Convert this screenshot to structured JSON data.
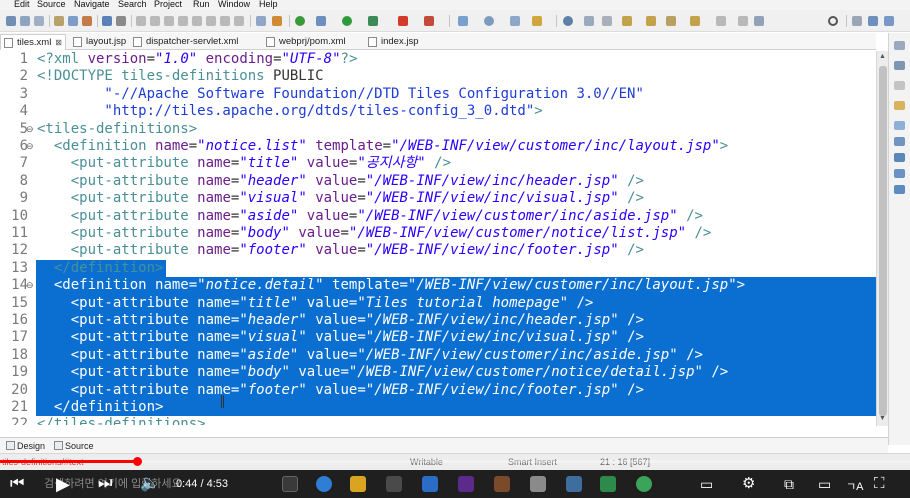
{
  "menu": [
    "Edit",
    "Source",
    "Navigate",
    "Search",
    "Project",
    "Run",
    "Window",
    "Help"
  ],
  "tabs": [
    {
      "label": "tiles.xml",
      "active": true,
      "close": "⊠"
    },
    {
      "label": "layout.jsp"
    },
    {
      "label": "dispatcher-servlet.xml"
    },
    {
      "label": "webprj/pom.xml"
    },
    {
      "label": "index.jsp"
    }
  ],
  "line_numbers": [
    "1",
    "2",
    "3",
    "4",
    "5",
    "6",
    "7",
    "8",
    "9",
    "10",
    "11",
    "12",
    "13",
    "14",
    "15",
    "16",
    "17",
    "18",
    "19",
    "20",
    "21",
    "22"
  ],
  "code_lines": [
    [
      [
        "t",
        "<?xml "
      ],
      [
        "a",
        "version"
      ],
      [
        "d",
        "="
      ],
      [
        "v",
        "\"1.0\""
      ],
      [
        "d",
        " "
      ],
      [
        "a",
        "encoding"
      ],
      [
        "d",
        "="
      ],
      [
        "v",
        "\"UTF-8\""
      ],
      [
        "t",
        "?>"
      ]
    ],
    [
      [
        "t",
        "<!DOCTYPE tiles-definitions "
      ],
      [
        "d",
        "PUBLIC"
      ]
    ],
    [
      [
        "p",
        "        \"-//Apache Software Foundation//DTD Tiles Configuration 3.0//EN\""
      ]
    ],
    [
      [
        "p",
        "        \"http://tiles.apache.org/dtds/tiles-config_3_0.dtd\""
      ],
      [
        "t",
        ">"
      ]
    ],
    [
      [
        "t",
        "<tiles-definitions>"
      ]
    ],
    [
      [
        "t",
        "  <definition "
      ],
      [
        "a",
        "name"
      ],
      [
        "d",
        "="
      ],
      [
        "v",
        "\"notice.list\""
      ],
      [
        "d",
        " "
      ],
      [
        "a",
        "template"
      ],
      [
        "d",
        "="
      ],
      [
        "v",
        "\"/WEB-INF/view/customer/inc/layout.jsp\""
      ],
      [
        "t",
        ">"
      ]
    ],
    [
      [
        "t",
        "    <put-attribute "
      ],
      [
        "a",
        "name"
      ],
      [
        "d",
        "="
      ],
      [
        "v",
        "\"title\""
      ],
      [
        "d",
        " "
      ],
      [
        "a",
        "value"
      ],
      [
        "d",
        "="
      ],
      [
        "v",
        "\"공지사항\""
      ],
      [
        "t",
        " />"
      ]
    ],
    [
      [
        "t",
        "    <put-attribute "
      ],
      [
        "a",
        "name"
      ],
      [
        "d",
        "="
      ],
      [
        "v",
        "\"header\""
      ],
      [
        "d",
        " "
      ],
      [
        "a",
        "value"
      ],
      [
        "d",
        "="
      ],
      [
        "v",
        "\"/WEB-INF/view/inc/header.jsp\""
      ],
      [
        "t",
        " />"
      ]
    ],
    [
      [
        "t",
        "    <put-attribute "
      ],
      [
        "a",
        "name"
      ],
      [
        "d",
        "="
      ],
      [
        "v",
        "\"visual\""
      ],
      [
        "d",
        " "
      ],
      [
        "a",
        "value"
      ],
      [
        "d",
        "="
      ],
      [
        "v",
        "\"/WEB-INF/view/inc/visual.jsp\""
      ],
      [
        "t",
        " />"
      ]
    ],
    [
      [
        "t",
        "    <put-attribute "
      ],
      [
        "a",
        "name"
      ],
      [
        "d",
        "="
      ],
      [
        "v",
        "\"aside\""
      ],
      [
        "d",
        " "
      ],
      [
        "a",
        "value"
      ],
      [
        "d",
        "="
      ],
      [
        "v",
        "\"/WEB-INF/view/customer/inc/aside.jsp\""
      ],
      [
        "t",
        " />"
      ]
    ],
    [
      [
        "t",
        "    <put-attribute "
      ],
      [
        "a",
        "name"
      ],
      [
        "d",
        "="
      ],
      [
        "v",
        "\"body\""
      ],
      [
        "d",
        " "
      ],
      [
        "a",
        "value"
      ],
      [
        "d",
        "="
      ],
      [
        "v",
        "\"/WEB-INF/view/customer/notice/list.jsp\""
      ],
      [
        "t",
        " />"
      ]
    ],
    [
      [
        "t",
        "    <put-attribute "
      ],
      [
        "a",
        "name"
      ],
      [
        "d",
        "="
      ],
      [
        "v",
        "\"footer\""
      ],
      [
        "d",
        " "
      ],
      [
        "a",
        "value"
      ],
      [
        "d",
        "="
      ],
      [
        "v",
        "\"/WEB-INF/view/inc/footer.jsp\""
      ],
      [
        "t",
        " />"
      ]
    ],
    [
      [
        "t",
        "  </definition>"
      ]
    ],
    [
      [
        "t",
        "  <definition "
      ],
      [
        "a",
        "name"
      ],
      [
        "d",
        "="
      ],
      [
        "v",
        "\"notice.detail\""
      ],
      [
        "d",
        " "
      ],
      [
        "a",
        "template"
      ],
      [
        "d",
        "="
      ],
      [
        "v",
        "\"/WEB-INF/view/customer/inc/layout.jsp\""
      ],
      [
        "t",
        ">"
      ]
    ],
    [
      [
        "t",
        "    <put-attribute "
      ],
      [
        "a",
        "name"
      ],
      [
        "d",
        "="
      ],
      [
        "v",
        "\"title\""
      ],
      [
        "d",
        " "
      ],
      [
        "a",
        "value"
      ],
      [
        "d",
        "="
      ],
      [
        "v",
        "\"Tiles tutorial homepage\""
      ],
      [
        "t",
        " />"
      ]
    ],
    [
      [
        "t",
        "    <put-attribute "
      ],
      [
        "a",
        "name"
      ],
      [
        "d",
        "="
      ],
      [
        "v",
        "\"header\""
      ],
      [
        "d",
        " "
      ],
      [
        "a",
        "value"
      ],
      [
        "d",
        "="
      ],
      [
        "v",
        "\"/WEB-INF/view/inc/header.jsp\""
      ],
      [
        "t",
        " />"
      ]
    ],
    [
      [
        "t",
        "    <put-attribute "
      ],
      [
        "a",
        "name"
      ],
      [
        "d",
        "="
      ],
      [
        "v",
        "\"visual\""
      ],
      [
        "d",
        " "
      ],
      [
        "a",
        "value"
      ],
      [
        "d",
        "="
      ],
      [
        "v",
        "\"/WEB-INF/view/inc/visual.jsp\""
      ],
      [
        "t",
        " />"
      ]
    ],
    [
      [
        "t",
        "    <put-attribute "
      ],
      [
        "a",
        "name"
      ],
      [
        "d",
        "="
      ],
      [
        "v",
        "\"aside\""
      ],
      [
        "d",
        " "
      ],
      [
        "a",
        "value"
      ],
      [
        "d",
        "="
      ],
      [
        "v",
        "\"/WEB-INF/view/customer/inc/aside.jsp\""
      ],
      [
        "t",
        " />"
      ]
    ],
    [
      [
        "t",
        "    <put-attribute "
      ],
      [
        "a",
        "name"
      ],
      [
        "d",
        "="
      ],
      [
        "v",
        "\"body\""
      ],
      [
        "d",
        " "
      ],
      [
        "a",
        "value"
      ],
      [
        "d",
        "="
      ],
      [
        "v",
        "\"/WEB-INF/view/customer/notice/detail.jsp\""
      ],
      [
        "t",
        " />"
      ]
    ],
    [
      [
        "t",
        "    <put-attribute "
      ],
      [
        "a",
        "name"
      ],
      [
        "d",
        "="
      ],
      [
        "v",
        "\"footer\""
      ],
      [
        "d",
        " "
      ],
      [
        "a",
        "value"
      ],
      [
        "d",
        "="
      ],
      [
        "v",
        "\"/WEB-INF/view/inc/footer.jsp\""
      ],
      [
        "t",
        " />"
      ]
    ],
    [
      [
        "t",
        "  </definition>"
      ]
    ],
    [
      [
        "t",
        "</tiles-definitions>"
      ]
    ]
  ],
  "bottom_tabs": {
    "design": "Design",
    "source": "Source"
  },
  "status": {
    "path": "tiles-definitions/#text",
    "mode": "Writable",
    "insert": "Smart Insert",
    "position": "21 : 16 [567]"
  },
  "video": {
    "time": "0:44 / 4:53",
    "played_fraction": 0.15
  },
  "colors": {
    "selection": "#0a6fd1",
    "tag": "#4a8f96",
    "attr": "#6b1d8b",
    "value": "#2a00ff",
    "progress": "#ff0000"
  }
}
